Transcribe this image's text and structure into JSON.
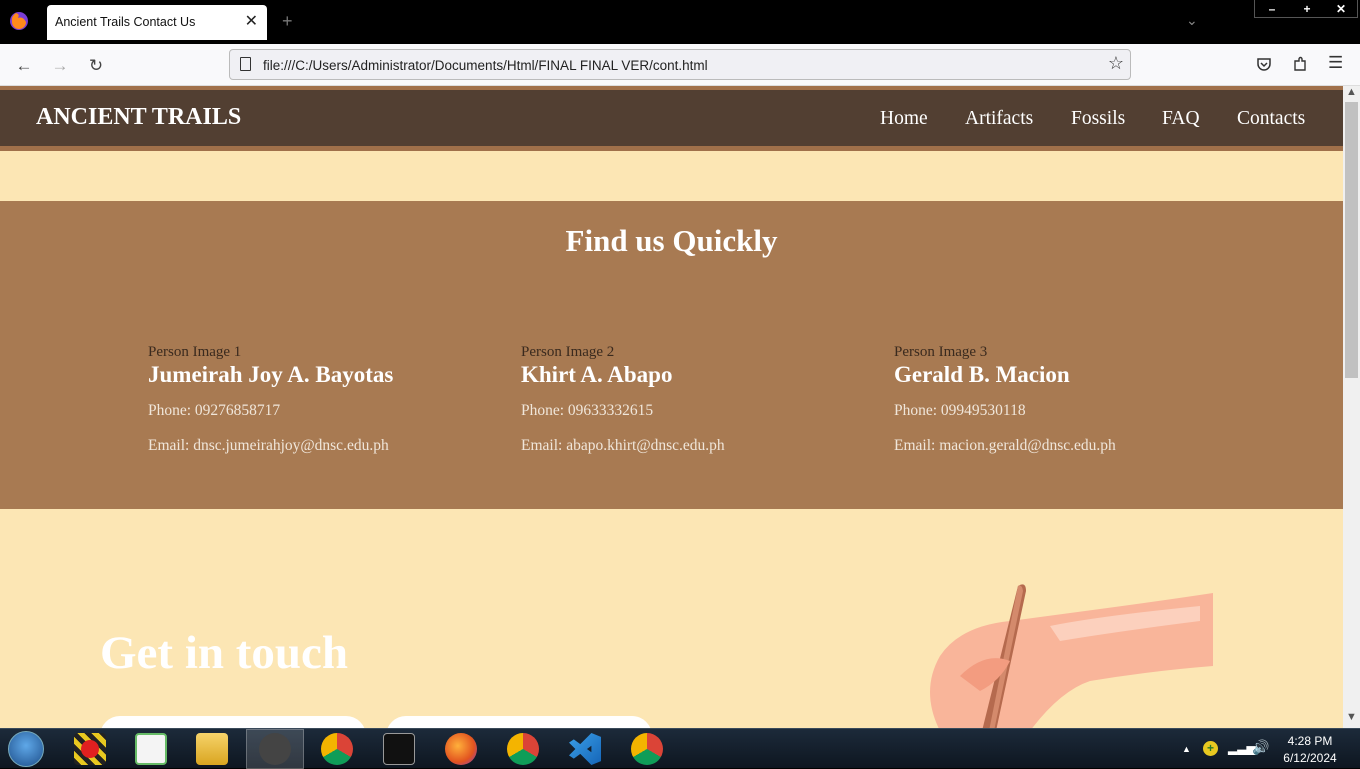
{
  "browser": {
    "tab_title": "Ancient Trails Contact Us",
    "url": "file:///C:/Users/Administrator/Documents/Html/FINAL FINAL VER/cont.html"
  },
  "site": {
    "brand": "ANCIENT TRAILS",
    "nav": [
      "Home",
      "Artifacts",
      "Fossils",
      "FAQ",
      "Contacts"
    ]
  },
  "findus": {
    "title": "Find us Quickly",
    "people": [
      {
        "image_alt": "Person Image 1",
        "name": "Jumeirah Joy A. Bayotas",
        "phone": "Phone: 09276858717",
        "email": "Email: dnsc.jumeirahjoy@dnsc.edu.ph"
      },
      {
        "image_alt": "Person Image 2",
        "name": "Khirt A. Abapo",
        "phone": "Phone: 09633332615",
        "email": "Email: abapo.khirt@dnsc.edu.ph"
      },
      {
        "image_alt": "Person Image 3",
        "name": "Gerald B. Macion",
        "phone": "Phone: 09949530118",
        "email": "Email: macion.gerald@dnsc.edu.ph"
      }
    ]
  },
  "contact": {
    "heading": "Get in touch"
  },
  "taskbar": {
    "time": "4:28 PM",
    "date": "6/12/2024"
  },
  "colors": {
    "header_bg": "#523f32",
    "accent": "#a87a52",
    "page_bg": "#fce6b4"
  }
}
